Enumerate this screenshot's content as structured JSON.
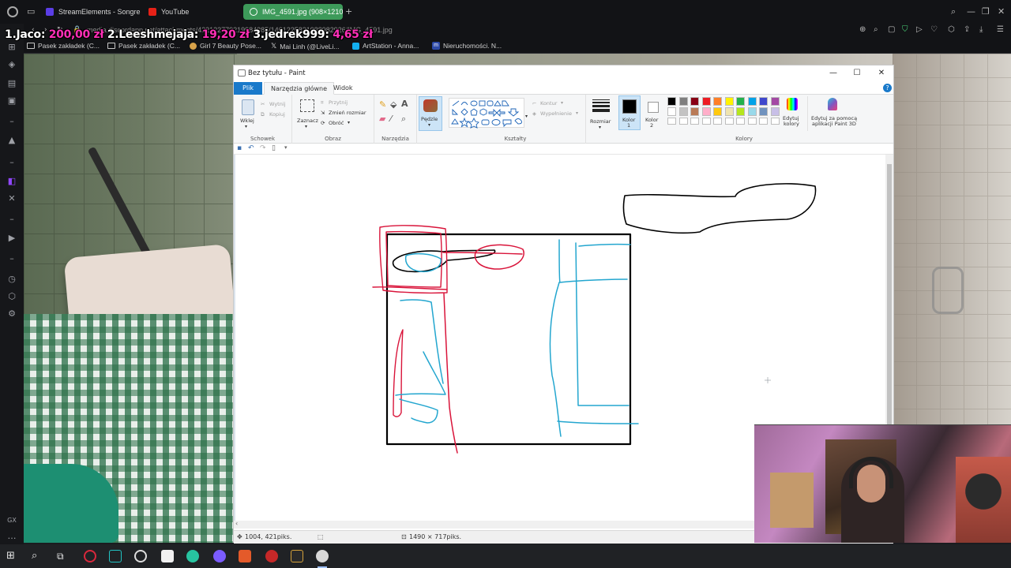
{
  "browser": {
    "tabs": [
      {
        "label": "StreamElements - Songre",
        "icon_color": "#5b3ee6"
      },
      {
        "label": "YouTube",
        "icon_color": "#e62117"
      },
      {
        "label": "IMG_4591.jpg (908×1210)",
        "icon_color": "#ffffff",
        "active": true
      }
    ],
    "new_tab": "+",
    "url": "media.discordapp.net/attachments/422122779219984385/1401225821988982926/IMG_4591.jpg",
    "bookmarks": [
      {
        "label": "Pasek zakładek (C...",
        "icon": "folder-icon"
      },
      {
        "label": "Pasek zakładek (C...",
        "icon": "folder-icon"
      },
      {
        "label": "Girl 7 Beauty Pose...",
        "icon": "site-icon"
      },
      {
        "label": "Mai Linh (@LiveLi...",
        "icon": "x-icon"
      },
      {
        "label": "ArtStation - Anna...",
        "icon": "artstation-icon"
      },
      {
        "label": "Nieruchomości. N...",
        "icon": "m-icon"
      }
    ]
  },
  "donations": {
    "items": [
      {
        "rank": "1.Jaco:",
        "amount": "200,00 zł"
      },
      {
        "rank": "2.Leeshmejaja:",
        "amount": "19,20 zł"
      },
      {
        "rank": "3.jedrek999:",
        "amount": "4,65 zł"
      }
    ]
  },
  "paint": {
    "title": "Bez tytułu - Paint",
    "tabs": [
      "Plik",
      "Narzędzia główne",
      "Widok"
    ],
    "ribbon": {
      "clipboard": {
        "paste": "Wklej",
        "cut": "Wytnij",
        "copy": "Kopiuj",
        "group": "Schowek"
      },
      "image": {
        "select": "Zaznacz",
        "crop": "Przytnij",
        "resize": "Zmień rozmiar",
        "rotate": "Obróć",
        "group": "Obraz"
      },
      "tools": {
        "group": "Narzędzia"
      },
      "brushes": {
        "label": "Pędzle"
      },
      "shapes": {
        "outline": "Kontur",
        "fill": "Wypełnienie",
        "group": "Kształty"
      },
      "size": {
        "label": "Rozmiar"
      },
      "color1": {
        "label": "Kolor",
        "num": "1"
      },
      "color2": {
        "label": "Kolor",
        "num": "2"
      },
      "colors": {
        "group": "Kolory",
        "edit": "Edytuj kolory",
        "edit_line1": "Edytuj",
        "edit_line2": "kolory",
        "paint3d_line1": "Edytuj za pomocą",
        "paint3d_line2": "aplikacji Paint 3D",
        "palette_row1": [
          "#000000",
          "#7f7f7f",
          "#880015",
          "#ed1c24",
          "#ff7f27",
          "#fff200",
          "#22b14c",
          "#00a2e8",
          "#3f48cc",
          "#a349a4"
        ],
        "palette_row2": [
          "#ffffff",
          "#c3c3c3",
          "#b97a57",
          "#ffaec9",
          "#ffc90e",
          "#efe4b0",
          "#b5e61d",
          "#99d9ea",
          "#7092be",
          "#c8bfe7"
        ]
      }
    },
    "drawing": {
      "colors": {
        "black": "#000000",
        "red": "#d9143a",
        "blue": "#23a6cf"
      }
    },
    "status": {
      "cursor": "1004, 421piks.",
      "size": "1490 × 717piks."
    }
  }
}
